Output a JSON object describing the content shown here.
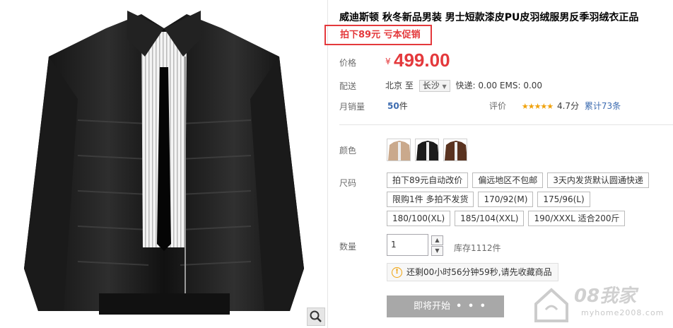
{
  "product": {
    "title": "威迪斯顿 秋冬新品男装 男士短款漆皮PU皮羽绒服男反季羽绒衣正品",
    "promo": "拍下89元 亏本促销"
  },
  "price": {
    "label": "价格",
    "currency": "¥",
    "value": "499.00"
  },
  "shipping": {
    "label": "配送",
    "from": "北京",
    "to_word": "至",
    "city": "长沙",
    "fees": "快递: 0.00 EMS: 0.00"
  },
  "sales": {
    "label": "月销量",
    "count": "50",
    "unit": "件",
    "rating_label": "评价",
    "stars": "★★★★★",
    "score": "4.7分",
    "reviews": "累计73条"
  },
  "color": {
    "label": "颜色",
    "options": [
      "tan",
      "black",
      "brown"
    ]
  },
  "size": {
    "label": "尺码",
    "options": [
      "拍下89元自动改价",
      "偏远地区不包邮",
      "3天内发货默认圆通快递",
      "限购1件 多拍不发货",
      "170/92(M)",
      "175/96(L)",
      "180/100(XL)",
      "185/104(XXL)",
      "190/XXXL 适合200斤"
    ]
  },
  "quantity": {
    "label": "数量",
    "value": "1",
    "stock": "库存1112件"
  },
  "countdown": {
    "text": "还剩00小时56分钟59秒,请先收藏商品"
  },
  "buy_button": {
    "label": "即将开始",
    "dots": "• • •"
  },
  "watermark": {
    "main": "08我家",
    "sub": "myhome2008.com"
  },
  "colors": {
    "accent": "#e4393c",
    "link": "#3c6bb0",
    "star": "#f0a20c"
  }
}
